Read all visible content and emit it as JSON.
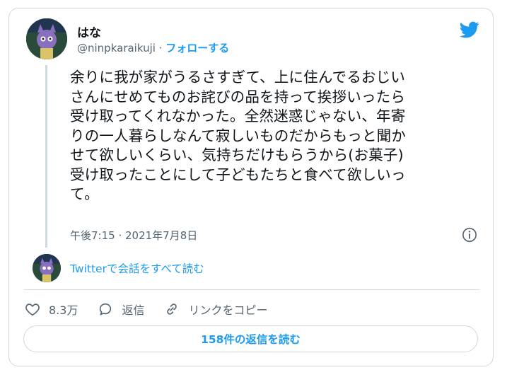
{
  "tweet": {
    "author_name": "はな",
    "author_handle": "@ninpkaraikuji",
    "separator": " · ",
    "follow_label": "フォローする",
    "text": "余りに我が家がうるさすぎて、上に住んでるおじい\nさんにせめてものお詫びの品を持って挨拶いったら\n受け取ってくれなかった。全然迷惑じゃない、年寄\nりの一人暮らしなんて寂しいものだからもっと聞か\nせて欲しいくらい、気持ちだけもらうから(お菓子)\n受け取ったことにして子どもたちと食べて欲しいっ\nて。",
    "timestamp": "午後7:15 · 2021年7月8日",
    "read_conversation": "Twitterで会話をすべて読む",
    "likes": "8.3万",
    "reply_label": "返信",
    "copy_link_label": "リンクをコピー",
    "read_replies": "158件の返信を読む"
  },
  "colors": {
    "accent": "#1d9bf0",
    "text": "#0f1419",
    "secondary": "#536471",
    "border": "#cfd9de"
  },
  "icons": [
    "twitter-bird-icon",
    "info-icon",
    "heart-icon",
    "reply-bubble-icon",
    "link-icon"
  ]
}
